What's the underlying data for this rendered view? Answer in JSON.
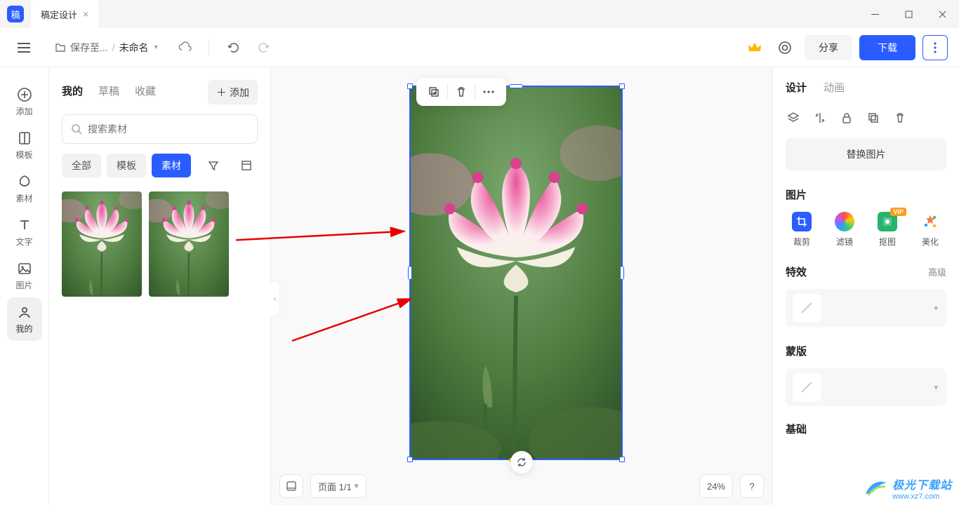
{
  "titlebar": {
    "app_glyph": "稿",
    "tab_title": "稿定设计"
  },
  "toolbar": {
    "save_prefix": "保存至...",
    "doc_name": "未命名",
    "share": "分享",
    "download": "下载"
  },
  "nav": {
    "items": [
      {
        "label": "添加"
      },
      {
        "label": "模板"
      },
      {
        "label": "素材"
      },
      {
        "label": "文字"
      },
      {
        "label": "图片"
      },
      {
        "label": "我的"
      }
    ]
  },
  "assets": {
    "tabs": {
      "mine": "我的",
      "drafts": "草稿",
      "fav": "收藏"
    },
    "add_label": "添加",
    "search_placeholder": "搜索素材",
    "chips": {
      "all": "全部",
      "templates": "模板",
      "materials": "素材"
    }
  },
  "canvas": {
    "page_label": "页面 1/1",
    "zoom": "24%",
    "help": "?"
  },
  "right": {
    "tabs": {
      "design": "设计",
      "animation": "动画"
    },
    "replace": "替换图片",
    "sec_image": "图片",
    "tools": {
      "crop": "裁剪",
      "filter": "滤镜",
      "cutout": "抠图",
      "beauty": "美化",
      "vip": "VIP"
    },
    "sec_effects": "特效",
    "advanced": "高级",
    "sec_mask": "蒙版",
    "sec_basic": "基础"
  },
  "watermark": {
    "zh": "极光下载站",
    "url": "www.xz7.com"
  }
}
